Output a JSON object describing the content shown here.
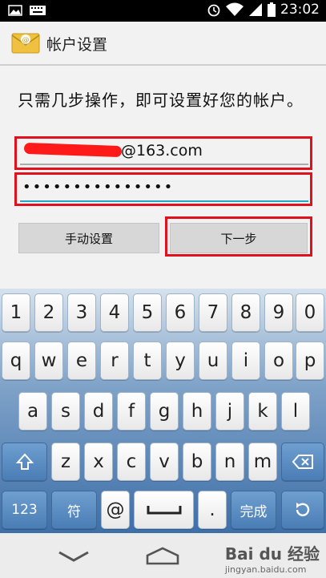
{
  "status_bar": {
    "time": "23:02",
    "icons": [
      "image-icon",
      "keyboard-icon",
      "alarm-icon",
      "wifi-icon",
      "signal-icon",
      "battery-icon"
    ]
  },
  "action_bar": {
    "title": "帐户设置",
    "icon": "email-app-icon"
  },
  "content": {
    "instruction": "只需几步操作，即可设置好您的帐户。",
    "email_value_suffix": "@163.com",
    "password_value": "•••••••••••••••",
    "manual_setup_label": "手动设置",
    "next_label": "下一步"
  },
  "keyboard": {
    "row1": [
      "1",
      "2",
      "3",
      "4",
      "5",
      "6",
      "7",
      "8",
      "9",
      "0"
    ],
    "row2": [
      "q",
      "w",
      "e",
      "r",
      "t",
      "y",
      "u",
      "i",
      "o",
      "p"
    ],
    "row3": [
      "a",
      "s",
      "d",
      "f",
      "g",
      "h",
      "j",
      "k",
      "l"
    ],
    "row4": [
      "z",
      "x",
      "c",
      "v",
      "b",
      "n",
      "m"
    ],
    "row5": {
      "num_label": "123",
      "symbol_label": "符",
      "at_label": "@",
      "period_label": ".",
      "done_label": "完成"
    }
  },
  "watermark": {
    "logo": "Bai du 经验",
    "url": "jingyan.baidu.com"
  },
  "colors": {
    "highlight": "#e0101c",
    "accent": "#2a9fc7",
    "keyboard_top": "#d6e2ee",
    "keyboard_bottom": "#3e6fa8"
  }
}
